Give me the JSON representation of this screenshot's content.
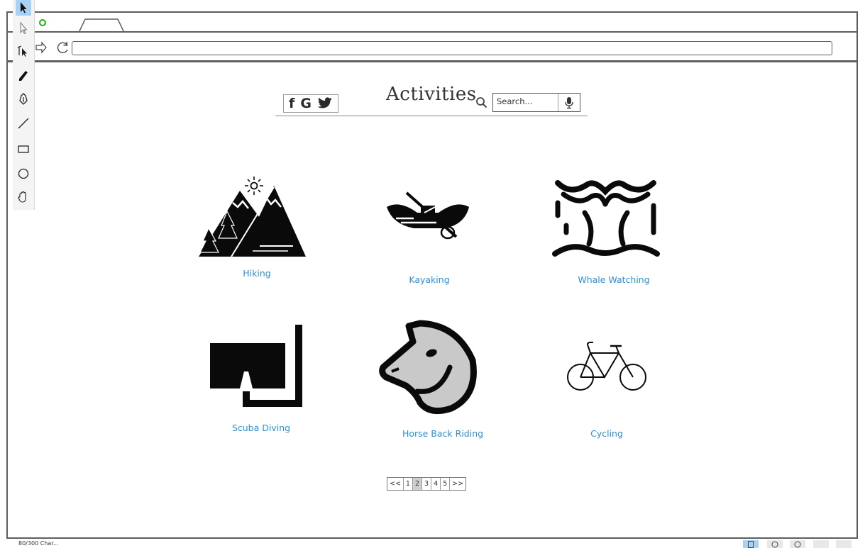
{
  "page": {
    "title": "Activities",
    "search_placeholder": "Search..."
  },
  "social": {
    "facebook": "f",
    "google": "G"
  },
  "activities": [
    {
      "label": "Hiking",
      "icon": "mountains-icon"
    },
    {
      "label": "Kayaking",
      "icon": "kayak-icon"
    },
    {
      "label": "Whale Watching",
      "icon": "whale-tail-icon"
    },
    {
      "label": "Scuba Diving",
      "icon": "snorkel-mask-icon"
    },
    {
      "label": "Horse Back Riding",
      "icon": "horse-head-icon"
    },
    {
      "label": "Cycling",
      "icon": "bicycle-icon"
    }
  ],
  "pagination": {
    "prev": "<<",
    "pages": [
      "1",
      "2",
      "3",
      "4",
      "5"
    ],
    "next": ">>",
    "current": "2"
  },
  "tools": [
    "select-arrow-icon",
    "pointer-icon",
    "pointer-pin-icon",
    "pencil-icon",
    "pen-icon",
    "line-icon",
    "rectangle-icon",
    "circle-icon",
    "hand-icon"
  ],
  "colors": {
    "link_blue": "#2f8fd6",
    "frame_gray": "#5e5e5e",
    "status_green": "#19b219",
    "tool_selected": "#a9d1f5"
  },
  "status_bar": {
    "text": "80/300 Char..."
  }
}
